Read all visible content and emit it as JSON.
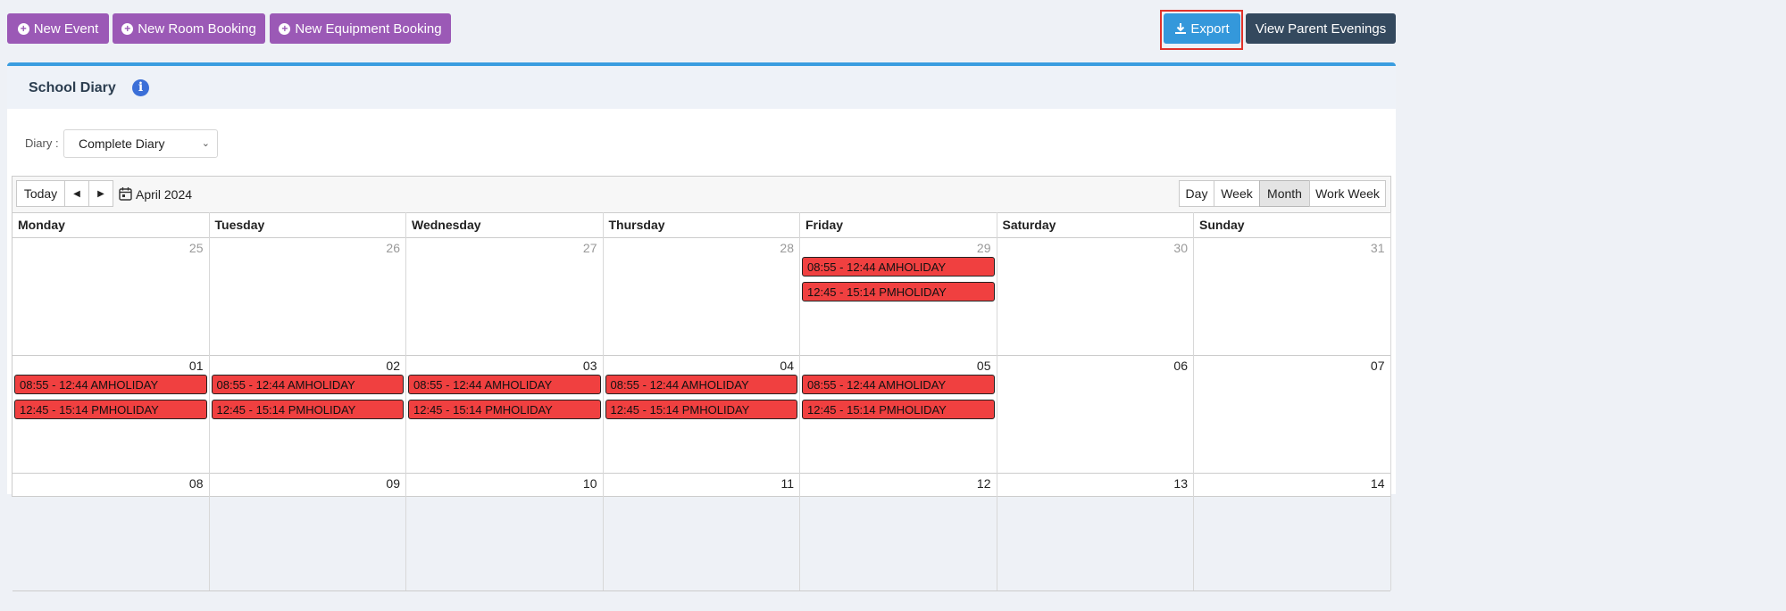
{
  "toolbar": {
    "new_event": "New Event",
    "new_room_booking": "New Room Booking",
    "new_equipment_booking": "New Equipment Booking",
    "export": "Export",
    "view_parent_evenings": "View Parent Evenings"
  },
  "panel": {
    "title": "School Diary",
    "diary_label": "Diary :",
    "diary_selected": "Complete Diary"
  },
  "calendar": {
    "today": "Today",
    "month_label": "April 2024",
    "views": [
      "Day",
      "Week",
      "Month",
      "Work Week"
    ],
    "active_view": "Month",
    "days_of_week": [
      "Monday",
      "Tuesday",
      "Wednesday",
      "Thursday",
      "Friday",
      "Saturday",
      "Sunday"
    ],
    "weeks": [
      {
        "days": [
          {
            "num": "25",
            "other_month": true,
            "events": []
          },
          {
            "num": "26",
            "other_month": true,
            "events": []
          },
          {
            "num": "27",
            "other_month": true,
            "events": []
          },
          {
            "num": "28",
            "other_month": true,
            "events": []
          },
          {
            "num": "29",
            "other_month": true,
            "events": [
              "08:55 - 12:44 AMHOLIDAY",
              "12:45 - 15:14 PMHOLIDAY"
            ]
          },
          {
            "num": "30",
            "other_month": true,
            "events": []
          },
          {
            "num": "31",
            "other_month": true,
            "events": []
          }
        ]
      },
      {
        "days": [
          {
            "num": "01",
            "other_month": false,
            "events": [
              "08:55 - 12:44 AMHOLIDAY",
              "12:45 - 15:14 PMHOLIDAY"
            ]
          },
          {
            "num": "02",
            "other_month": false,
            "events": [
              "08:55 - 12:44 AMHOLIDAY",
              "12:45 - 15:14 PMHOLIDAY"
            ]
          },
          {
            "num": "03",
            "other_month": false,
            "events": [
              "08:55 - 12:44 AMHOLIDAY",
              "12:45 - 15:14 PMHOLIDAY"
            ]
          },
          {
            "num": "04",
            "other_month": false,
            "events": [
              "08:55 - 12:44 AMHOLIDAY",
              "12:45 - 15:14 PMHOLIDAY"
            ]
          },
          {
            "num": "05",
            "other_month": false,
            "events": [
              "08:55 - 12:44 AMHOLIDAY",
              "12:45 - 15:14 PMHOLIDAY"
            ]
          },
          {
            "num": "06",
            "other_month": false,
            "events": []
          },
          {
            "num": "07",
            "other_month": false,
            "events": []
          }
        ]
      },
      {
        "days": [
          {
            "num": "08",
            "other_month": false,
            "events": []
          },
          {
            "num": "09",
            "other_month": false,
            "events": []
          },
          {
            "num": "10",
            "other_month": false,
            "events": []
          },
          {
            "num": "11",
            "other_month": false,
            "events": []
          },
          {
            "num": "12",
            "other_month": false,
            "events": []
          },
          {
            "num": "13",
            "other_month": false,
            "events": []
          },
          {
            "num": "14",
            "other_month": false,
            "events": []
          }
        ]
      }
    ]
  },
  "colors": {
    "purple_button": "#9b59b6",
    "export_blue": "#3498db",
    "dark_button": "#34495e",
    "event_red": "#f04040",
    "highlight_outline": "#e0322a"
  }
}
